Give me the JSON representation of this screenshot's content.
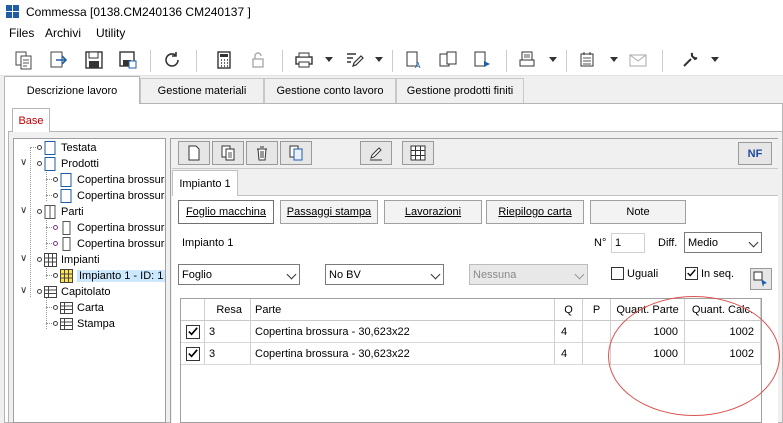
{
  "window": {
    "title": "Commessa   [0138.CM240136 CM240137 ]",
    "icon": "app-grid-icon",
    "accent": "#1e5ea8"
  },
  "menu": [
    "Files",
    "Archivi",
    "Utility"
  ],
  "toolbar": {
    "icons": [
      "copy-doc-icon",
      "export-doc-icon",
      "save-icon",
      "save-as-icon",
      "refresh-icon",
      "calculator-icon",
      "lock-icon",
      "print-icon",
      "edit-icon",
      "report-a-icon",
      "report-b-icon",
      "report-c-icon",
      "print-preview-icon",
      "list-settings-icon",
      "email-icon",
      "wrench-icon"
    ]
  },
  "top_tabs": [
    "Descrizione lavoro",
    "Gestione materiali",
    "Gestione conto lavoro",
    "Gestione prodotti finiti"
  ],
  "base_tab": "Base",
  "tree": {
    "nodes": [
      {
        "label": "Testata",
        "icon": "document-icon"
      },
      {
        "label": "Prodotti",
        "icon": "document-icon"
      },
      {
        "label": "Copertina brossura",
        "icon": "document-icon"
      },
      {
        "label": "Copertina brossura",
        "icon": "document-icon"
      },
      {
        "label": "Parti",
        "icon": "columns-icon"
      },
      {
        "label": "Copertina brossura",
        "icon": "column-icon"
      },
      {
        "label": "Copertina brossura",
        "icon": "column-icon"
      },
      {
        "label": "Impianti",
        "icon": "grid-icon"
      },
      {
        "label": "Impianto 1 - ID: 1",
        "icon": "yellow-grid-icon"
      },
      {
        "label": "Capitolato",
        "icon": "table-icon"
      },
      {
        "label": "Carta",
        "icon": "table-icon"
      },
      {
        "label": "Stampa",
        "icon": "table-icon"
      }
    ]
  },
  "subtoolbar": {
    "icons": [
      "new-doc-icon",
      "copy-doc-icon",
      "delete-icon",
      "paste-doc-icon",
      "pencil-icon",
      "grid-icon"
    ],
    "nf_label": "NF"
  },
  "impianto_tab": "Impianto 1",
  "section_tabs": [
    "Foglio macchina",
    "Passaggi stampa",
    "Lavorazioni",
    "Riepilogo carta",
    "Note"
  ],
  "form": {
    "name": "Impianto 1",
    "n_label": "N°",
    "n_value": "1",
    "diff_label": "Diff.",
    "diff_value": "Medio",
    "combo1": "Foglio",
    "combo2": "No BV",
    "combo3": "Nessuna",
    "uguali_label": "Uguali",
    "uguali_checked": false,
    "inseq_label": "In seq.",
    "inseq_checked": true
  },
  "grid": {
    "headers": [
      "Resa",
      "Parte",
      "Q",
      "P",
      "Quant. Parte",
      "Quant. Calc."
    ],
    "rows": [
      {
        "checked": true,
        "resa": "3",
        "parte": "Copertina brossura - 30,623x22",
        "q": "4",
        "p": "",
        "quant_parte": "1000",
        "quant_calc": "1002"
      },
      {
        "checked": true,
        "resa": "3",
        "parte": "Copertina brossura - 30,623x22",
        "q": "4",
        "p": "",
        "quant_parte": "1000",
        "quant_calc": "1002"
      }
    ]
  },
  "annotation_color": "#d9534f"
}
